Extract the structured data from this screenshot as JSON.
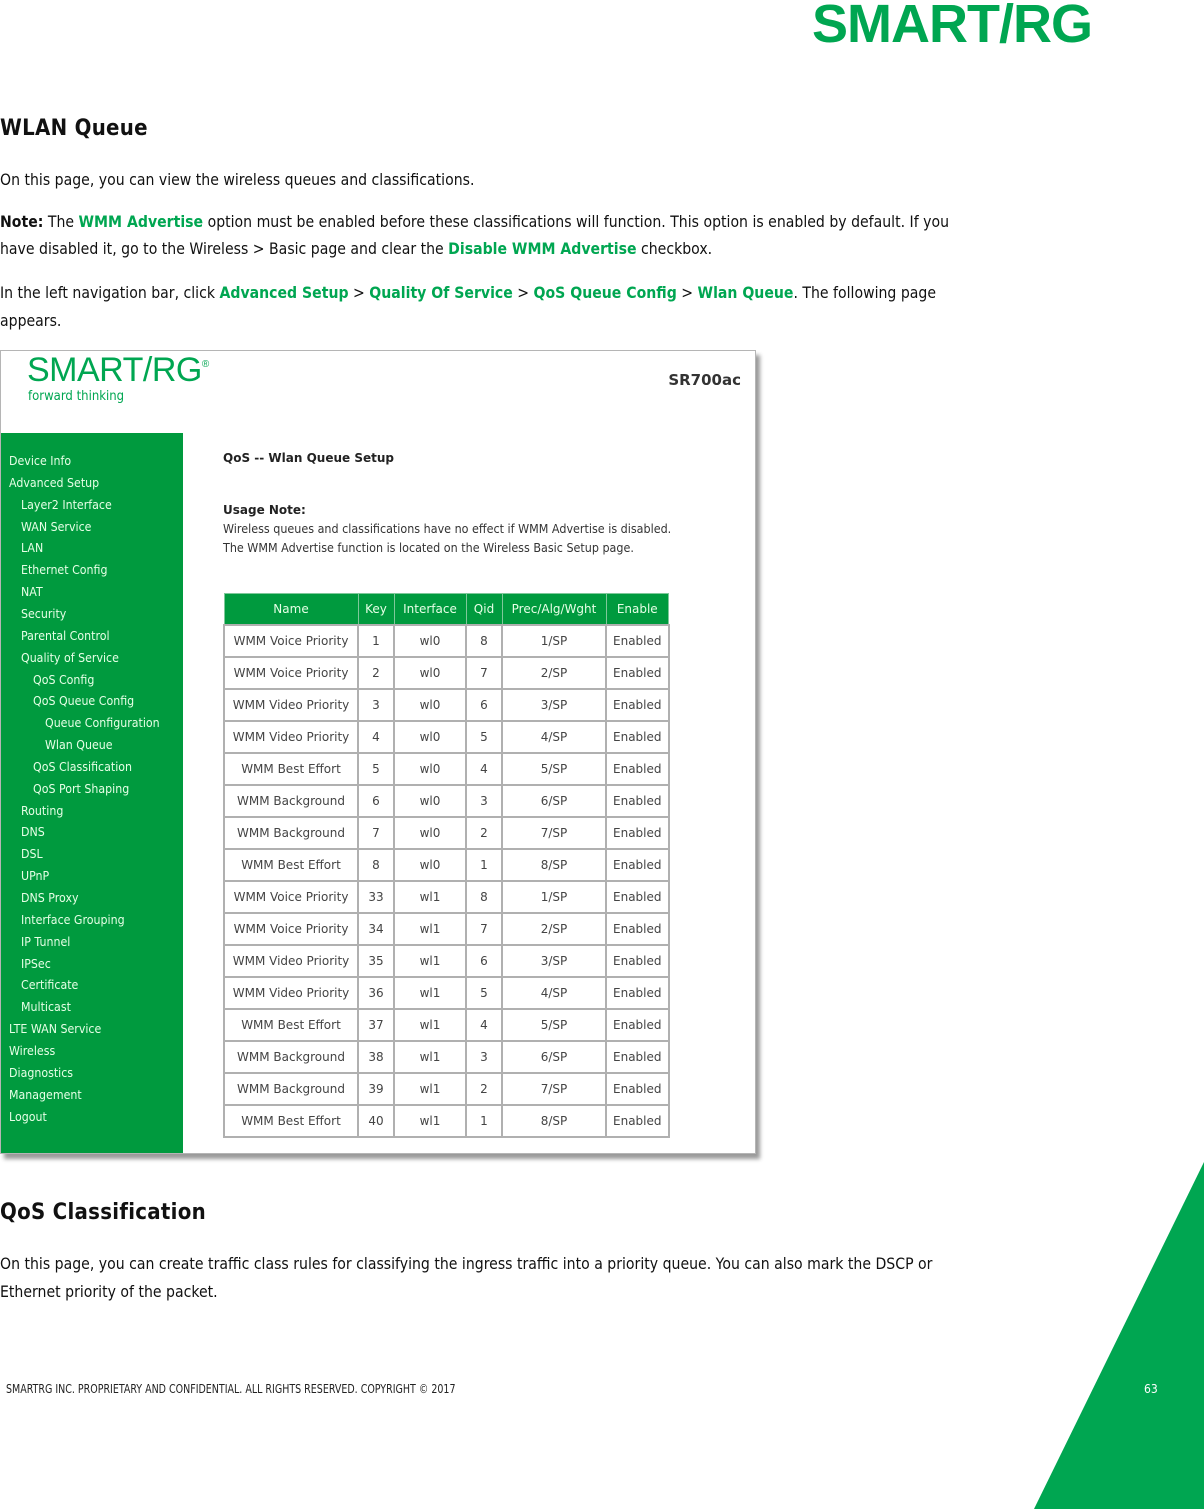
{
  "header": {
    "brand": "SMART/RG"
  },
  "section1": {
    "title": "WLAN Queue",
    "intro": "On this page, you can view the wireless queues and classifications.",
    "note": {
      "label": "Note:",
      "t1": " The ",
      "l1": "WMM Advertise",
      "t2": " option must be enabled before these classifications will function. This option is enabled by default. If you",
      "t3": "have disabled it, go to the Wireless > Basic page and clear the ",
      "l2": "Disable WMM Advertise",
      "t4": " checkbox."
    },
    "nav_instr": {
      "t1": "In the left navigation bar, click ",
      "l1": "Advanced Setup",
      "sep": " > ",
      "l2": "Quality Of Service",
      "l3": "QoS Queue Config",
      "l4": "Wlan Queue",
      "t2": ". The following page",
      "t3": "appears."
    }
  },
  "screenshot": {
    "logo": "SMART/RG",
    "logo_mark": "®",
    "tagline": "forward thinking",
    "model": "SR700ac",
    "nav": [
      {
        "label": "Device Info",
        "level": 0
      },
      {
        "label": "Advanced Setup",
        "level": 0
      },
      {
        "label": "Layer2 Interface",
        "level": 1
      },
      {
        "label": "WAN Service",
        "level": 1
      },
      {
        "label": "LAN",
        "level": 1
      },
      {
        "label": "Ethernet Config",
        "level": 1
      },
      {
        "label": "NAT",
        "level": 1
      },
      {
        "label": "Security",
        "level": 1
      },
      {
        "label": "Parental Control",
        "level": 1
      },
      {
        "label": "Quality of Service",
        "level": 1
      },
      {
        "label": "QoS Config",
        "level": 2
      },
      {
        "label": "QoS Queue Config",
        "level": 2
      },
      {
        "label": "Queue Configuration",
        "level": 3
      },
      {
        "label": "Wlan Queue",
        "level": 3
      },
      {
        "label": "QoS Classification",
        "level": 2
      },
      {
        "label": "QoS Port Shaping",
        "level": 2
      },
      {
        "label": "Routing",
        "level": 1
      },
      {
        "label": "DNS",
        "level": 1
      },
      {
        "label": "DSL",
        "level": 1
      },
      {
        "label": "UPnP",
        "level": 1
      },
      {
        "label": "DNS Proxy",
        "level": 1
      },
      {
        "label": "Interface Grouping",
        "level": 1
      },
      {
        "label": "IP Tunnel",
        "level": 1
      },
      {
        "label": "IPSec",
        "level": 1
      },
      {
        "label": "Certificate",
        "level": 1
      },
      {
        "label": "Multicast",
        "level": 1
      },
      {
        "label": "LTE WAN Service",
        "level": 0
      },
      {
        "label": "Wireless",
        "level": 0
      },
      {
        "label": "Diagnostics",
        "level": 0
      },
      {
        "label": "Management",
        "level": 0
      },
      {
        "label": "Logout",
        "level": 0
      }
    ],
    "panel_title": "QoS -- Wlan Queue Setup",
    "usage_heading": "Usage Note:",
    "usage_line1": "Wireless queues and classifications have no effect if WMM Advertise is disabled.",
    "usage_line2": "The WMM Advertise function is located on the Wireless Basic Setup page.",
    "table": {
      "columns": [
        "Name",
        "Key",
        "Interface",
        "Qid",
        "Prec/Alg/Wght",
        "Enable"
      ],
      "rows": [
        [
          "WMM Voice Priority",
          "1",
          "wl0",
          "8",
          "1/SP",
          "Enabled"
        ],
        [
          "WMM Voice Priority",
          "2",
          "wl0",
          "7",
          "2/SP",
          "Enabled"
        ],
        [
          "WMM Video Priority",
          "3",
          "wl0",
          "6",
          "3/SP",
          "Enabled"
        ],
        [
          "WMM Video Priority",
          "4",
          "wl0",
          "5",
          "4/SP",
          "Enabled"
        ],
        [
          "WMM Best Effort",
          "5",
          "wl0",
          "4",
          "5/SP",
          "Enabled"
        ],
        [
          "WMM Background",
          "6",
          "wl0",
          "3",
          "6/SP",
          "Enabled"
        ],
        [
          "WMM Background",
          "7",
          "wl0",
          "2",
          "7/SP",
          "Enabled"
        ],
        [
          "WMM Best Effort",
          "8",
          "wl0",
          "1",
          "8/SP",
          "Enabled"
        ],
        [
          "WMM Voice Priority",
          "33",
          "wl1",
          "8",
          "1/SP",
          "Enabled"
        ],
        [
          "WMM Voice Priority",
          "34",
          "wl1",
          "7",
          "2/SP",
          "Enabled"
        ],
        [
          "WMM Video Priority",
          "35",
          "wl1",
          "6",
          "3/SP",
          "Enabled"
        ],
        [
          "WMM Video Priority",
          "36",
          "wl1",
          "5",
          "4/SP",
          "Enabled"
        ],
        [
          "WMM Best Effort",
          "37",
          "wl1",
          "4",
          "5/SP",
          "Enabled"
        ],
        [
          "WMM Background",
          "38",
          "wl1",
          "3",
          "6/SP",
          "Enabled"
        ],
        [
          "WMM Background",
          "39",
          "wl1",
          "2",
          "7/SP",
          "Enabled"
        ],
        [
          "WMM Best Effort",
          "40",
          "wl1",
          "1",
          "8/SP",
          "Enabled"
        ]
      ]
    }
  },
  "section2": {
    "title": "QoS Classification",
    "line1": "On this page, you can create traffic class rules for classifying the ingress traffic into a priority queue. You can also mark the DSCP or",
    "line2": "Ethernet priority of the packet."
  },
  "footer": {
    "copyright": "SMARTRG INC. PROPRIETARY AND CONFIDENTIAL. ALL RIGHTS RESERVED. COPYRIGHT © 2017",
    "page_number": "63"
  },
  "colors": {
    "brand_green": "#00a651",
    "nav_green": "#009a3e"
  }
}
